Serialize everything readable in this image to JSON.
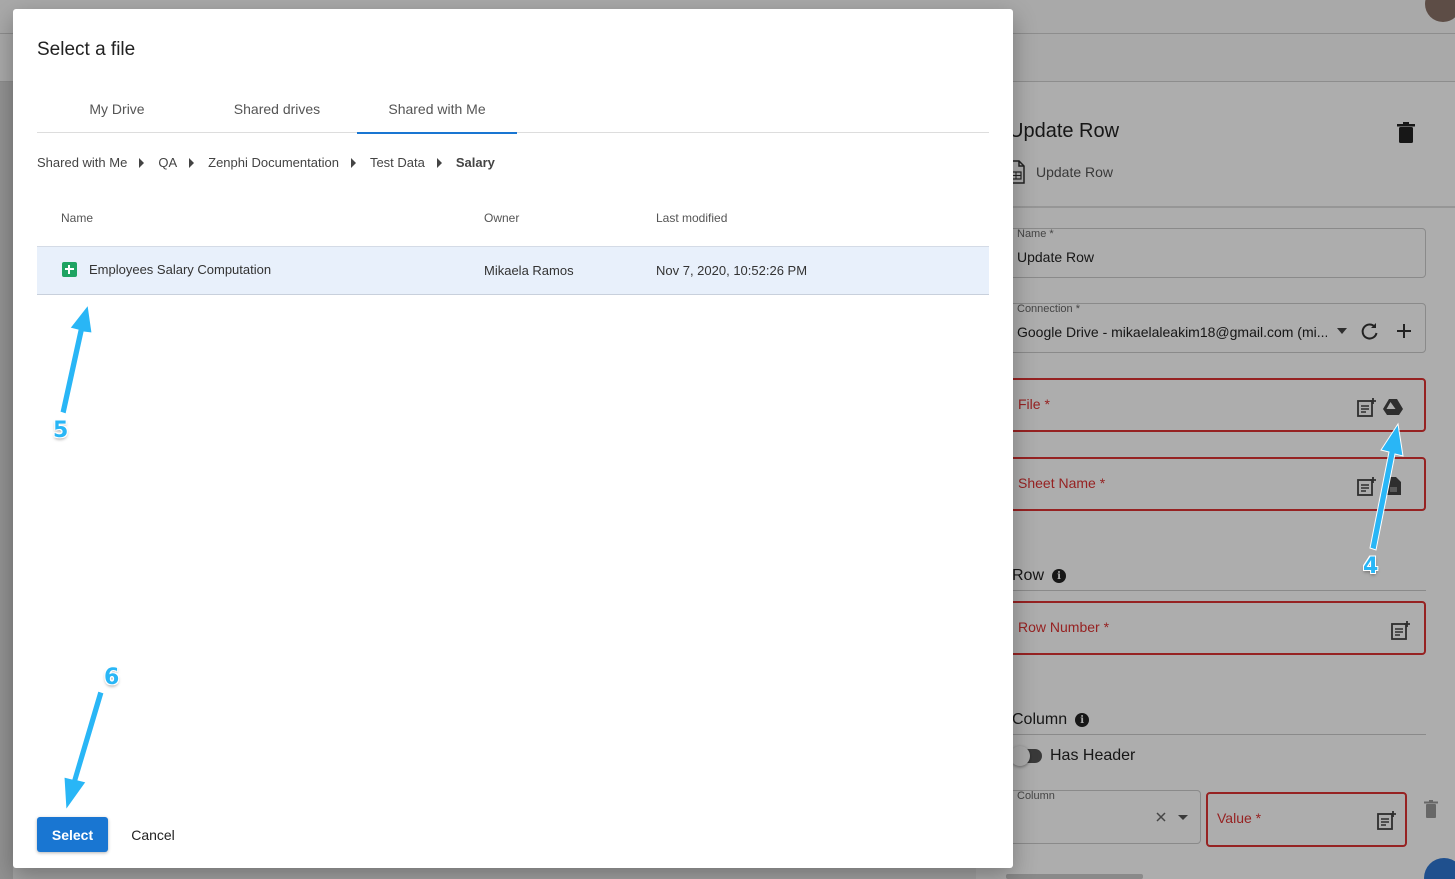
{
  "dialog": {
    "title": "Select a file",
    "tabs": [
      {
        "label": "My Drive",
        "active": false
      },
      {
        "label": "Shared drives",
        "active": false
      },
      {
        "label": "Shared with Me",
        "active": true
      }
    ],
    "breadcrumbs": [
      "Shared with Me",
      "QA",
      "Zenphi Documentation",
      "Test Data",
      "Salary"
    ],
    "columns": {
      "name": "Name",
      "owner": "Owner",
      "modified": "Last modified"
    },
    "rows": [
      {
        "icon": "google-sheets-icon",
        "name": "Employees Salary Computation",
        "owner": "Mikaela Ramos",
        "modified": "Nov 7, 2020, 10:52:26 PM",
        "selected": true
      }
    ],
    "select_label": "Select",
    "cancel_label": "Cancel"
  },
  "panel": {
    "title": "Update Row",
    "subtitle": "Update Row",
    "name_label": "Name *",
    "name_value": "Update Row",
    "connection_label": "Connection *",
    "connection_value": "Google Drive - mikaelaleakim18@gmail.com (mi...",
    "file_placeholder": "File *",
    "sheet_placeholder": "Sheet Name *",
    "row_section": "Row",
    "row_number_placeholder": "Row Number *",
    "column_section": "Column",
    "has_header_label": "Has Header",
    "has_header_on": false,
    "column_label": "Column",
    "value_placeholder": "Value *"
  },
  "annotations": [
    "5",
    "6",
    "4"
  ],
  "colors": {
    "accent": "#1976d2",
    "error": "#d33333",
    "annotation": "#29b6f6",
    "sheets": "#1ea362"
  }
}
